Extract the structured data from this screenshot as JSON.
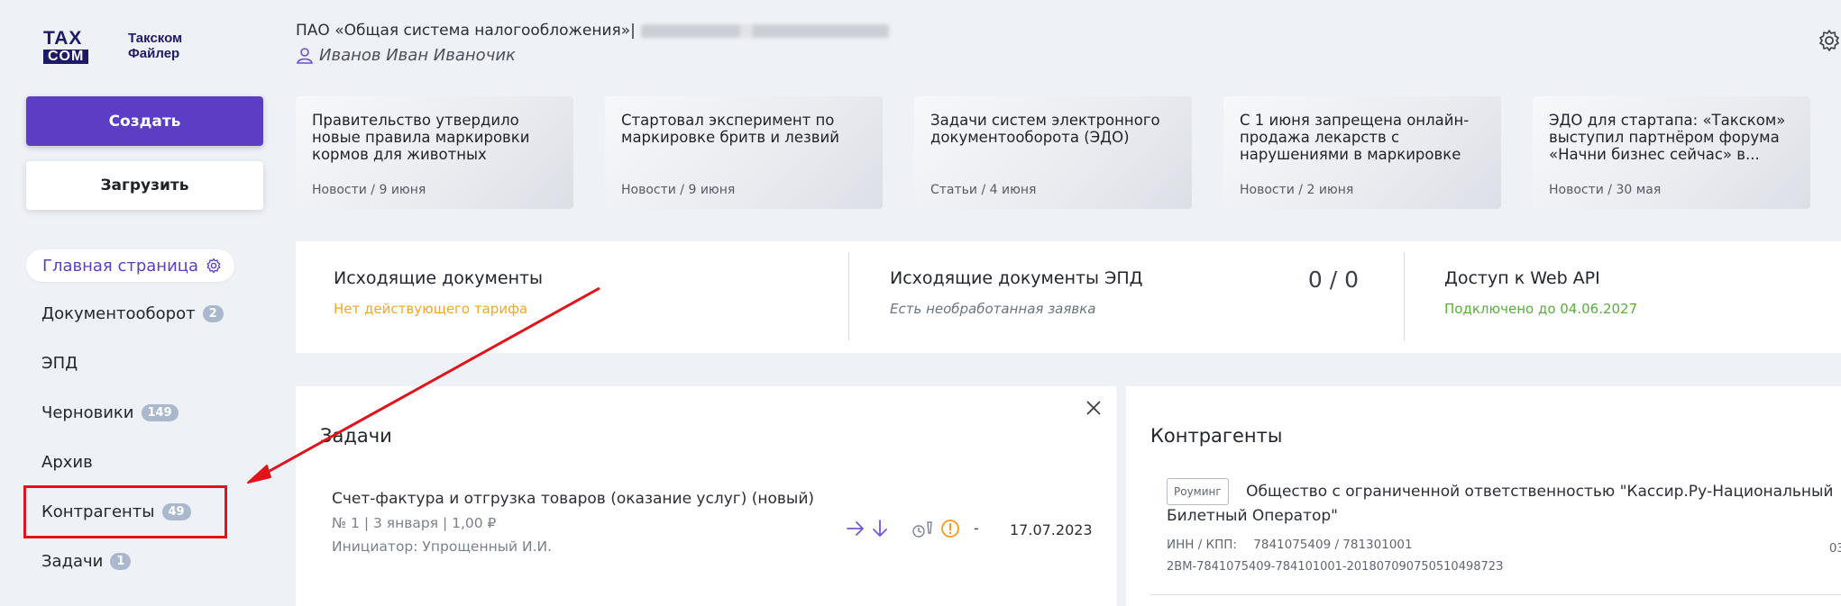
{
  "brand": {
    "logo_top": "TAX",
    "logo_bottom": "COM",
    "app_line1": "Такском",
    "app_line2": "Файлер"
  },
  "header": {
    "org_name": "ПАО «Общая система налогообложения»|",
    "user_name": "Иванов Иван Иваночик"
  },
  "actions": {
    "create_label": "Создать",
    "upload_label": "Загрузить"
  },
  "sidebar": {
    "home_label": "Главная страница",
    "items": [
      {
        "label": "Документооборот",
        "badge": "2"
      },
      {
        "label": "ЭПД",
        "badge": ""
      },
      {
        "label": "Черновики",
        "badge": "149"
      },
      {
        "label": "Архив",
        "badge": ""
      },
      {
        "label": "Контрагенты",
        "badge": "49"
      },
      {
        "label": "Задачи",
        "badge": "1"
      }
    ]
  },
  "news": [
    {
      "title": "Правительство утвердило новые правила маркировки кормов для животных",
      "meta": "Новости / 9 июня"
    },
    {
      "title": "Стартовал эксперимент по маркировке бритв и лезвий",
      "meta": "Новости / 9 июня"
    },
    {
      "title": "Задачи систем электронного документооборота (ЭДО)",
      "meta": "Статьи / 4 июня"
    },
    {
      "title": "С 1 июня запрещена онлайн-продажа лекарств с нарушениями в маркировке",
      "meta": "Новости / 2 июня"
    },
    {
      "title": "ЭДО для стартапа: «Такском» выступил партнёром форума «Начни бизнес сейчас» в...",
      "meta": "Новости / 30 мая"
    }
  ],
  "stats": {
    "outgoing": {
      "title": "Исходящие документы",
      "status": "Нет действующего тарифа"
    },
    "outgoing_epd": {
      "title": "Исходящие документы ЭПД",
      "status": "Есть необработанная заявка",
      "count": "0 / 0"
    },
    "web_api": {
      "title": "Доступ к Web API",
      "status": "Подключено до 04.06.2027"
    }
  },
  "tasks": {
    "title": "Задачи",
    "item": {
      "title": "Счет-фактура и отгрузка товаров (оказание услуг) (новый)",
      "details": "№ 1 | 3 января | 1,00 ₽",
      "initiator": "Инициатор: Упрощенный И.И.",
      "dash": "-",
      "date": "17.07.2023"
    }
  },
  "contragents": {
    "title": "Контрагенты",
    "item": {
      "tag": "Роуминг",
      "name": "Общество с ограниченной ответственностью \"Кассир.Ру-Национальный Билетный Оператор\"",
      "inn_label": "ИНН / КПП:",
      "inn_value": "7841075409 / 781301001",
      "id": "2BM-7841075409-784101001-20180709075051049872З",
      "right_cut": "03"
    }
  },
  "colors": {
    "accent": "#5b3ec4",
    "warning": "#f5a623",
    "success": "#58b03c",
    "annotation": "#e3131b"
  }
}
